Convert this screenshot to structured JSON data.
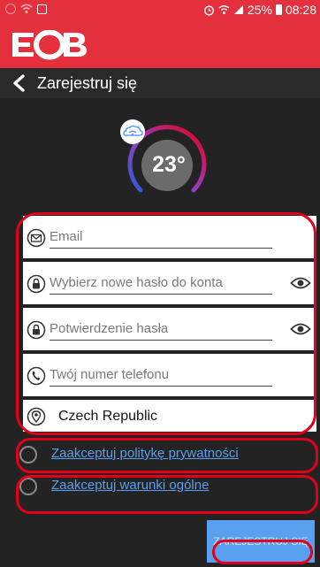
{
  "status_bar": {
    "battery_text": "25%",
    "time": "08:28",
    "icons": [
      "sync-icon",
      "wifi-icon",
      "square-icon",
      "alarm-icon",
      "wifi-signal-icon",
      "cell-signal-icon",
      "battery-icon"
    ]
  },
  "brand": {
    "logo_text": "EOB",
    "color": "#e3303c"
  },
  "nav": {
    "title": "Zarejestruj się",
    "back_icon": "chevron-left-icon"
  },
  "weather": {
    "temperature": "23°",
    "icon": "cloud-wifi-icon"
  },
  "form": {
    "email_placeholder": "Email",
    "password_placeholder": "Wybierz nowe hasło do konta",
    "confirm_placeholder": "Potwierdzenie hasła",
    "phone_placeholder": "Twój numer telefonu",
    "country": "Czech Republic"
  },
  "checks": {
    "privacy_label": "Zaakceptuj politykę prywatności",
    "terms_label": "Zaakceptuj warunki ogólne"
  },
  "submit_label": "ZAREJESTRUJ SIĘ",
  "colors": {
    "accent": "#5aa0f0",
    "annotation": "#e2001a",
    "background": "#232323"
  }
}
